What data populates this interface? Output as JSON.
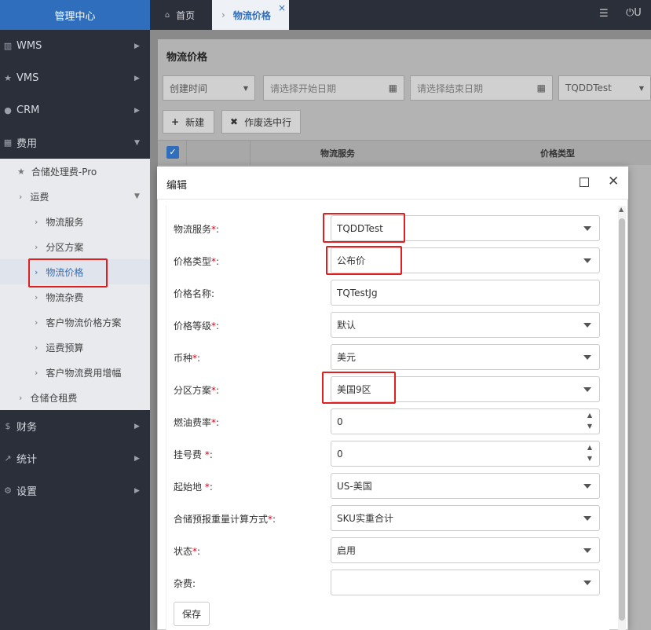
{
  "app": {
    "brand": "管理中心"
  },
  "sidebar": {
    "items": [
      {
        "label": "WMS",
        "icon": "bank-icon"
      },
      {
        "label": "VMS",
        "icon": "star-icon"
      },
      {
        "label": "CRM",
        "icon": "user-icon"
      },
      {
        "label": "费用",
        "icon": "grid-icon"
      }
    ],
    "sub": [
      {
        "label": "合储处理费-Pro"
      },
      {
        "label": "运费"
      },
      {
        "label": "物流服务"
      },
      {
        "label": "分区方案"
      },
      {
        "label": "物流价格"
      },
      {
        "label": "物流杂费"
      },
      {
        "label": "客户物流价格方案"
      },
      {
        "label": "运费预算"
      },
      {
        "label": "客户物流费用增幅"
      },
      {
        "label": "仓储仓租费"
      }
    ],
    "bottom": [
      {
        "label": "财务",
        "icon": "dollar-icon"
      },
      {
        "label": "统计",
        "icon": "chart-icon"
      },
      {
        "label": "设置",
        "icon": "gear-icon"
      }
    ]
  },
  "tabs": {
    "home": "首页",
    "active": "物流价格",
    "close": "×",
    "user": "U"
  },
  "panel": {
    "title": "物流价格",
    "filter": {
      "date_type": "创建时间",
      "start_ph": "请选择开始日期",
      "end_ph": "请选择结束日期",
      "service": "TQDDTest"
    },
    "buttons": {
      "new": "新建",
      "void": "作废选中行"
    },
    "columns": {
      "service": "物流服务",
      "price_type": "价格类型"
    }
  },
  "modal": {
    "title": "编辑",
    "fields": [
      {
        "label": "物流服务",
        "req": "*",
        "sep": ":",
        "value": "TQDDTest"
      },
      {
        "label": "价格类型",
        "req": "*",
        "sep": ":",
        "value": "公布价"
      },
      {
        "label": "价格名称",
        "req": "",
        "sep": ":",
        "value": "TQTestJg"
      },
      {
        "label": "价格等级",
        "req": "*",
        "sep": ":",
        "value": "默认"
      },
      {
        "label": "币种",
        "req": "*",
        "sep": ":",
        "value": "美元"
      },
      {
        "label": "分区方案",
        "req": "*",
        "sep": ":",
        "value": "美国9区"
      },
      {
        "label": "燃油费率",
        "req": "*",
        "sep": ":",
        "value": "0"
      },
      {
        "label": "挂号费 ",
        "req": "*",
        "sep": ":",
        "value": "0"
      },
      {
        "label": "起始地 ",
        "req": "*",
        "sep": ":",
        "value": "US-美国"
      },
      {
        "label": "合储预报重量计算方式",
        "req": "*",
        "sep": ":",
        "value": "SKU实重合计"
      },
      {
        "label": "状态",
        "req": "*",
        "sep": ":",
        "value": "启用"
      },
      {
        "label": "杂费",
        "req": "",
        "sep": ":",
        "value": ""
      }
    ],
    "save": "保存"
  }
}
